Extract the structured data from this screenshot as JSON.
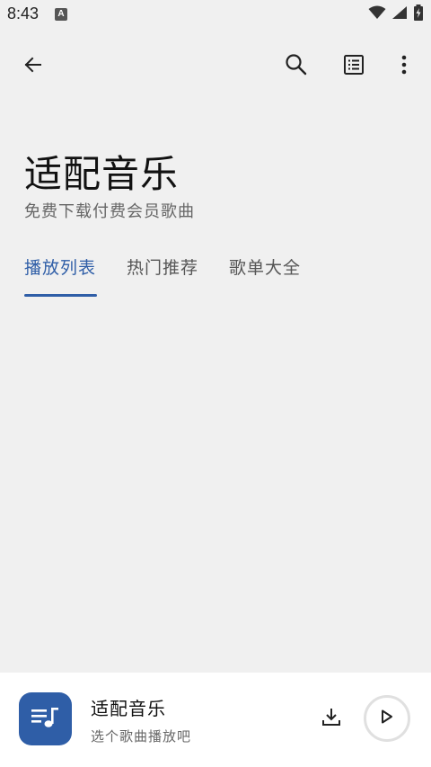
{
  "status_bar": {
    "time": "8:43",
    "notification_letter": "A",
    "icons": [
      "wifi-icon",
      "signal-icon",
      "battery-charging-icon"
    ]
  },
  "toolbar": {
    "icons": [
      "back-arrow-icon",
      "search-icon",
      "list-view-icon",
      "more-vert-icon"
    ]
  },
  "header": {
    "title": "适配音乐",
    "subtitle": "免费下载付费会员歌曲"
  },
  "tabs": [
    {
      "label": "播放列表",
      "active": true
    },
    {
      "label": "热门推荐",
      "active": false
    },
    {
      "label": "歌单大全",
      "active": false
    }
  ],
  "player": {
    "title": "适配音乐",
    "subtitle": "选个歌曲播放吧",
    "icons": [
      "queue-music-icon",
      "download-icon",
      "play-icon"
    ]
  },
  "colors": {
    "accent": "#2f5ea7",
    "background": "#f0f0f0",
    "player_background": "#ffffff"
  }
}
